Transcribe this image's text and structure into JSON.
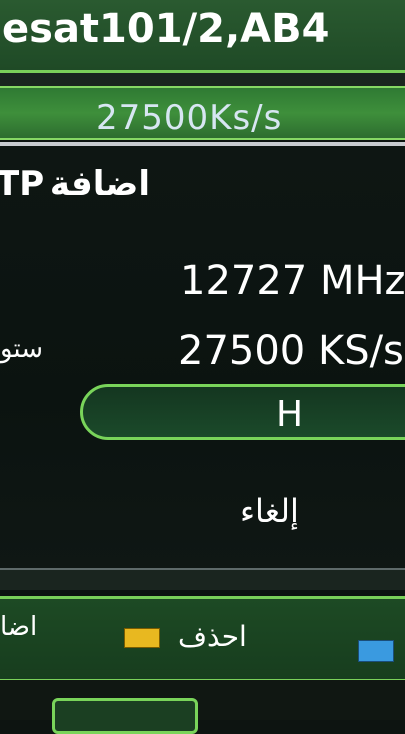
{
  "header": {
    "satellite_name": "esat101/2,AB4",
    "symbol_rate_display": "27500Ks/s"
  },
  "dialog": {
    "title": "اضافة",
    "title_prefix": "TP",
    "frequency": "12727 MHz",
    "symbol_rate": "27500 KS/s",
    "polarization_label": "ستو",
    "polarization_value": "H",
    "cancel_label": "إلغاء"
  },
  "footer": {
    "add_label": "اضا",
    "delete_label": "احذف",
    "key_colors": {
      "yellow": "#e8b820",
      "blue": "#3a9ae0"
    }
  },
  "theme": {
    "accent": "#79d45a",
    "panel_green": "#1d4a24"
  }
}
